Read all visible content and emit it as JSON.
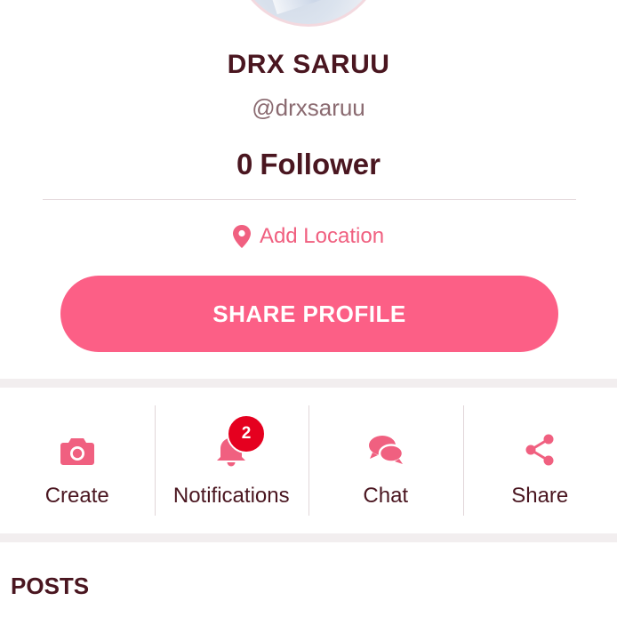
{
  "profile": {
    "name": "DRX SARUU",
    "handle": "@drxsaruu",
    "follower_count": "0",
    "follower_label": "Follower",
    "location_label": "Add Location",
    "share_button_label": "SHARE PROFILE"
  },
  "actions": [
    {
      "label": "Create",
      "icon": "camera-icon"
    },
    {
      "label": "Notifications",
      "icon": "bell-icon",
      "badge": "2"
    },
    {
      "label": "Chat",
      "icon": "chat-bubbles-icon"
    },
    {
      "label": "Share",
      "icon": "share-icon"
    }
  ],
  "sections": {
    "posts_title": "POSTS"
  },
  "colors": {
    "accent": "#fc5f86",
    "icon_pink": "#f06080",
    "text_dark": "#4a1620",
    "badge_red": "#e5001f"
  }
}
